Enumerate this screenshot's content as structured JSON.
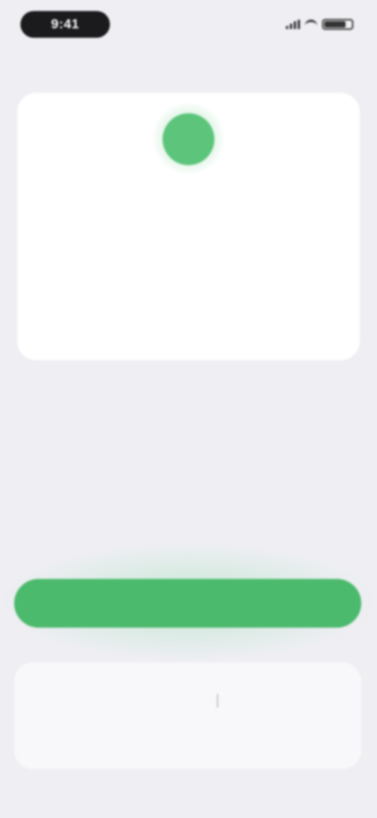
{
  "status_bar": {
    "time": "9:41"
  },
  "profile_card": {
    "avatar_initial": "",
    "rows": [
      {
        "label": "",
        "value": ""
      },
      {
        "label": "",
        "value": ""
      },
      {
        "label": "",
        "value": ""
      }
    ]
  },
  "primary_button": {
    "label": ""
  },
  "bottom_panel": {
    "left_action": {
      "label": "",
      "sub": ""
    },
    "right_action": {
      "label": "",
      "sub": ""
    }
  },
  "colors": {
    "background": "#eeeef3",
    "accent_green": "#4cba6d",
    "avatar_green": "#5cc57b",
    "card": "#ffffff"
  },
  "icons": [
    "signal-icon",
    "wifi-icon",
    "battery-icon"
  ]
}
